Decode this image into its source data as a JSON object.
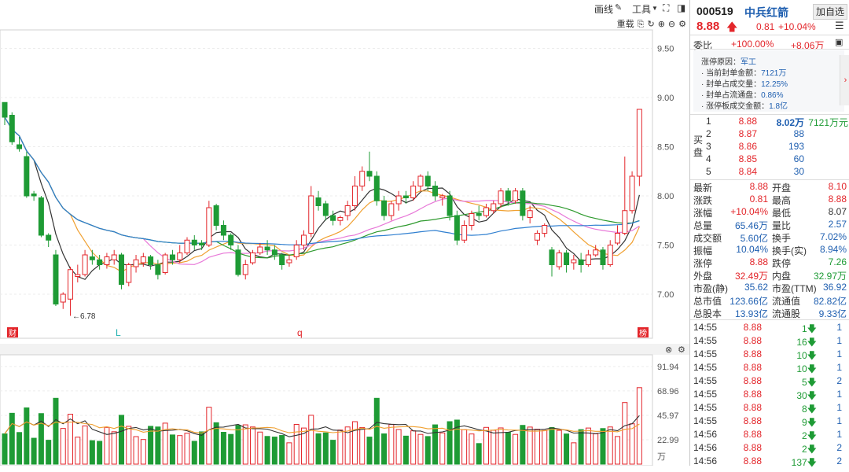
{
  "toolbar": {
    "draw_label": "画线",
    "tools_label": "工具",
    "restore_label": "重载"
  },
  "kline": {
    "price_axis": [
      "9.50",
      "9.00",
      "8.50",
      "8.00",
      "7.50",
      "7.00"
    ],
    "low_marker": "←6.78",
    "markers": {
      "cai": "财",
      "l": "L",
      "q": "q",
      "bang": "榜"
    },
    "candles": [
      [
        8.95,
        8.8,
        8.95,
        8.72
      ],
      [
        8.82,
        8.55,
        8.85,
        8.52
      ],
      [
        8.52,
        8.48,
        8.6,
        8.45
      ],
      [
        8.4,
        8.0,
        8.45,
        7.98
      ],
      [
        8.02,
        8.0,
        8.05,
        7.95
      ],
      [
        7.98,
        7.6,
        8.0,
        7.58
      ],
      [
        7.6,
        7.55,
        7.62,
        7.48
      ],
      [
        7.4,
        6.9,
        7.45,
        6.88
      ],
      [
        6.92,
        7.0,
        7.02,
        6.85
      ],
      [
        6.95,
        7.25,
        7.28,
        6.78
      ],
      [
        7.18,
        7.2,
        7.3,
        7.12
      ],
      [
        7.2,
        7.4,
        7.45,
        7.18
      ],
      [
        7.38,
        7.35,
        7.45,
        7.3
      ],
      [
        7.35,
        7.3,
        7.4,
        7.25
      ],
      [
        7.3,
        7.38,
        7.42,
        7.26
      ],
      [
        7.35,
        7.4,
        7.45,
        7.3
      ],
      [
        7.4,
        7.1,
        7.42,
        7.05
      ],
      [
        7.12,
        7.3,
        7.32,
        7.08
      ],
      [
        7.28,
        7.35,
        7.4,
        7.22
      ],
      [
        7.32,
        7.38,
        7.42,
        7.28
      ],
      [
        7.38,
        7.3,
        7.4,
        7.25
      ],
      [
        7.3,
        7.2,
        7.35,
        7.15
      ],
      [
        7.22,
        7.4,
        7.42,
        7.2
      ],
      [
        7.4,
        7.35,
        7.45,
        7.3
      ],
      [
        7.35,
        7.42,
        7.5,
        7.32
      ],
      [
        7.42,
        7.55,
        7.58,
        7.4
      ],
      [
        7.55,
        7.5,
        7.6,
        7.45
      ],
      [
        7.52,
        7.5,
        7.55,
        7.45
      ],
      [
        7.5,
        7.88,
        7.95,
        7.48
      ],
      [
        7.9,
        7.7,
        7.92,
        7.65
      ],
      [
        7.7,
        7.6,
        7.75,
        7.55
      ],
      [
        7.6,
        7.5,
        7.62,
        7.45
      ],
      [
        7.45,
        7.2,
        7.5,
        7.18
      ],
      [
        7.2,
        7.3,
        7.35,
        7.15
      ],
      [
        7.32,
        7.42,
        7.45,
        7.3
      ],
      [
        7.42,
        7.48,
        7.52,
        7.4
      ],
      [
        7.48,
        7.45,
        7.55,
        7.4
      ],
      [
        7.45,
        7.4,
        7.5,
        7.35
      ],
      [
        7.4,
        7.3,
        7.42,
        7.25
      ],
      [
        7.32,
        7.35,
        7.4,
        7.28
      ],
      [
        7.38,
        7.5,
        7.55,
        7.35
      ],
      [
        7.5,
        7.6,
        7.65,
        7.45
      ],
      [
        7.62,
        8.0,
        8.1,
        7.58
      ],
      [
        7.98,
        7.9,
        8.05,
        7.85
      ],
      [
        7.92,
        7.8,
        7.95,
        7.75
      ],
      [
        7.8,
        7.75,
        7.85,
        7.7
      ],
      [
        7.75,
        7.78,
        7.8,
        7.7
      ],
      [
        7.8,
        7.9,
        7.95,
        7.75
      ],
      [
        7.9,
        8.1,
        8.2,
        7.85
      ],
      [
        8.1,
        8.25,
        8.3,
        8.05
      ],
      [
        8.25,
        8.2,
        8.45,
        8.15
      ],
      [
        8.2,
        7.95,
        8.25,
        7.9
      ],
      [
        7.95,
        7.8,
        8.0,
        7.75
      ],
      [
        7.8,
        7.92,
        7.95,
        7.75
      ],
      [
        7.92,
        8.0,
        8.05,
        7.85
      ],
      [
        8.0,
        7.98,
        8.05,
        7.92
      ],
      [
        7.98,
        8.1,
        8.15,
        7.95
      ],
      [
        8.1,
        8.2,
        8.22,
        8.05
      ],
      [
        8.2,
        8.1,
        8.25,
        8.05
      ],
      [
        8.1,
        8.0,
        8.15,
        7.95
      ],
      [
        7.98,
        8.0,
        8.02,
        7.9
      ],
      [
        8.0,
        7.8,
        8.05,
        7.75
      ],
      [
        7.8,
        7.55,
        7.85,
        7.5
      ],
      [
        7.55,
        7.7,
        7.75,
        7.52
      ],
      [
        7.7,
        7.82,
        7.85,
        7.65
      ],
      [
        7.82,
        7.8,
        7.9,
        7.75
      ],
      [
        7.8,
        7.88,
        7.92,
        7.78
      ],
      [
        7.85,
        7.92,
        7.95,
        7.82
      ],
      [
        7.92,
        8.05,
        8.08,
        7.88
      ],
      [
        8.05,
        7.95,
        8.08,
        7.9
      ],
      [
        7.95,
        8.05,
        8.08,
        7.92
      ],
      [
        8.05,
        7.8,
        8.08,
        7.75
      ],
      [
        7.78,
        7.85,
        7.9,
        7.72
      ],
      [
        7.55,
        7.62,
        7.65,
        7.5
      ],
      [
        7.62,
        7.7,
        7.72,
        7.58
      ],
      [
        7.45,
        7.3,
        7.48,
        7.18
      ],
      [
        7.28,
        7.42,
        7.45,
        7.25
      ],
      [
        7.42,
        7.3,
        7.45,
        7.22
      ],
      [
        7.32,
        7.35,
        7.4,
        7.25
      ],
      [
        7.35,
        7.3,
        7.42,
        7.22
      ],
      [
        7.3,
        7.4,
        7.45,
        7.28
      ],
      [
        7.4,
        7.45,
        7.5,
        7.38
      ],
      [
        7.45,
        7.3,
        7.48,
        7.25
      ],
      [
        7.3,
        7.5,
        7.55,
        7.28
      ],
      [
        7.52,
        7.62,
        7.7,
        7.5
      ],
      [
        7.62,
        7.85,
        8.4,
        7.6
      ],
      [
        7.85,
        8.2,
        8.25,
        7.82
      ],
      [
        8.2,
        8.88,
        8.88,
        8.1
      ]
    ]
  },
  "volume": {
    "axis": [
      "91.94",
      "68.96",
      "45.97",
      "22.99",
      "万"
    ]
  },
  "quote": {
    "code": "000519",
    "name": "中兵红箭",
    "add_watch": "加自选",
    "price": "8.88",
    "change": "0.81",
    "pct": "+10.04%",
    "weibi_label": "委比",
    "weibi": "+100.00%",
    "weicha": "+8.06万"
  },
  "limit_info": {
    "reason_label": "涨停原因：",
    "reason": "军工",
    "seal_amount_label": "· 当前封单金额：",
    "seal_amount": "7121万",
    "seal_vol_label": "· 封单占成交量：",
    "seal_vol": "12.25%",
    "seal_float_label": "· 封单占流通盘：",
    "seal_float": "0.86%",
    "board_amount_label": "· 涨停板成交金额：",
    "board_amount": "1.8亿"
  },
  "orderbook": {
    "buy_label": [
      "买",
      "盘"
    ],
    "levels": [
      {
        "n": "1",
        "price": "8.88",
        "vol": "8.02万",
        "extra": "7121万元"
      },
      {
        "n": "2",
        "price": "8.87",
        "vol": "88",
        "extra": ""
      },
      {
        "n": "3",
        "price": "8.86",
        "vol": "193",
        "extra": ""
      },
      {
        "n": "4",
        "price": "8.85",
        "vol": "60",
        "extra": ""
      },
      {
        "n": "5",
        "price": "8.84",
        "vol": "30",
        "extra": ""
      }
    ]
  },
  "stats": [
    {
      "l1": "最新",
      "v1": "8.88",
      "c1": "red",
      "l2": "开盘",
      "v2": "8.10",
      "c2": "red"
    },
    {
      "l1": "涨跌",
      "v1": "0.81",
      "c1": "red",
      "l2": "最高",
      "v2": "8.88",
      "c2": "red"
    },
    {
      "l1": "涨幅",
      "v1": "+10.04%",
      "c1": "red",
      "l2": "最低",
      "v2": "8.07",
      "c2": "dark"
    },
    {
      "l1": "总量",
      "v1": "65.46万",
      "c1": "blue",
      "l2": "量比",
      "v2": "2.57",
      "c2": "blue"
    },
    {
      "l1": "成交额",
      "v1": "5.60亿",
      "c1": "blue",
      "l2": "换手",
      "v2": "7.02%",
      "c2": "blue"
    },
    {
      "l1": "振幅",
      "v1": "10.04%",
      "c1": "blue",
      "l2": "换手(实)",
      "v2": "8.94%",
      "c2": "blue"
    },
    {
      "l1": "涨停",
      "v1": "8.88",
      "c1": "red",
      "l2": "跌停",
      "v2": "7.26",
      "c2": "green"
    },
    {
      "l1": "外盘",
      "v1": "32.49万",
      "c1": "red",
      "l2": "内盘",
      "v2": "32.97万",
      "c2": "green"
    },
    {
      "l1": "市盈(静)",
      "v1": "35.62",
      "c1": "blue",
      "l2": "市盈(TTM)",
      "v2": "36.92",
      "c2": "blue"
    },
    {
      "l1": "总市值",
      "v1": "123.66亿",
      "c1": "blue",
      "l2": "流通值",
      "v2": "82.82亿",
      "c2": "blue"
    },
    {
      "l1": "总股本",
      "v1": "13.93亿",
      "c1": "blue",
      "l2": "流通股",
      "v2": "9.33亿",
      "c2": "blue"
    }
  ],
  "ticks": [
    {
      "t": "14:55",
      "p": "8.88",
      "v": "1",
      "n": "1"
    },
    {
      "t": "14:55",
      "p": "8.88",
      "v": "16",
      "n": "1"
    },
    {
      "t": "14:55",
      "p": "8.88",
      "v": "10",
      "n": "1"
    },
    {
      "t": "14:55",
      "p": "8.88",
      "v": "10",
      "n": "1"
    },
    {
      "t": "14:55",
      "p": "8.88",
      "v": "5",
      "n": "2"
    },
    {
      "t": "14:55",
      "p": "8.88",
      "v": "30",
      "n": "1"
    },
    {
      "t": "14:55",
      "p": "8.88",
      "v": "8",
      "n": "1"
    },
    {
      "t": "14:55",
      "p": "8.88",
      "v": "9",
      "n": "1"
    },
    {
      "t": "14:56",
      "p": "8.88",
      "v": "2",
      "n": "1"
    },
    {
      "t": "14:56",
      "p": "8.88",
      "v": "2",
      "n": "2"
    },
    {
      "t": "14:56",
      "p": "8.88",
      "v": "137",
      "n": "2"
    }
  ]
}
